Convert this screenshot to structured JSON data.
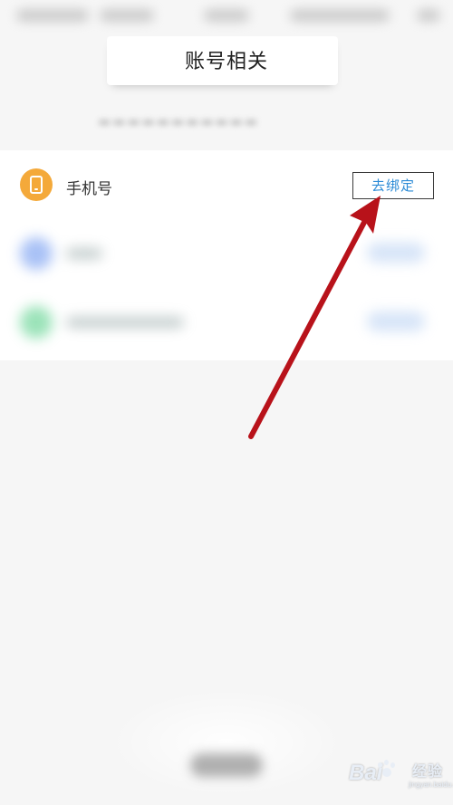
{
  "header": {
    "title": "账号相关"
  },
  "accounts": [
    {
      "label": "手机号",
      "action_label": "去绑定",
      "icon": "phone-icon",
      "color": "#f4a93a"
    },
    {
      "icon": "blurred-icon",
      "color": "#6f98f0"
    },
    {
      "icon": "blurred-icon",
      "color": "#58d08a"
    }
  ],
  "colors": {
    "accent_link": "#2c8bd6",
    "arrow": "#b8121a",
    "background": "#f6f6f6"
  },
  "watermark": {
    "brand": "Bai",
    "brand2": "du",
    "product": "经验",
    "url": "jingyan.baidu.com"
  }
}
